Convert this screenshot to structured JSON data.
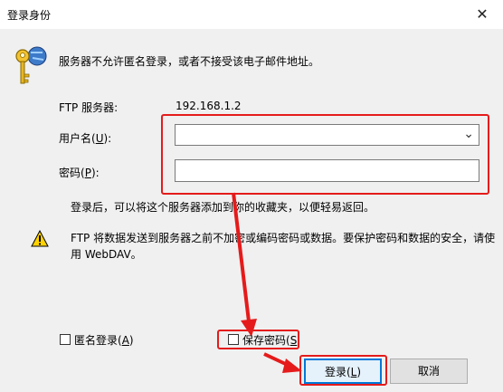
{
  "window": {
    "title": "登录身份",
    "close_glyph": "✕"
  },
  "message": "服务器不允许匿名登录，或者不接受该电子邮件地址。",
  "server": {
    "label": "FTP 服务器:",
    "value": "192.168.1.2"
  },
  "username": {
    "label_prefix": "用户名(",
    "label_key": "U",
    "label_suffix": "):",
    "value": ""
  },
  "password": {
    "label_prefix": "密码(",
    "label_key": "P",
    "label_suffix": "):",
    "value": ""
  },
  "info": "登录后，可以将这个服务器添加到你的收藏夹，以便轻易返回。",
  "warning": {
    "line1": "FTP 将数据发送到服务器之前不加密或编码密码或数据。要保护密码和数据的安全，请使",
    "line2": "用 WebDAV。"
  },
  "anonymous": {
    "label_prefix": "匿名登录(",
    "label_key": "A",
    "label_suffix": ")",
    "checked": false
  },
  "save_password": {
    "label_prefix": "保存密码(",
    "label_key": "S",
    "label_suffix": "",
    "checked": false
  },
  "buttons": {
    "login_prefix": "登录(",
    "login_key": "L",
    "login_suffix": ")",
    "cancel": "取消"
  },
  "colors": {
    "highlight": "#e51b1b",
    "default_button_border": "#0078d7"
  },
  "icons": [
    "keys-icon",
    "warning-icon",
    "chevron-down-icon",
    "close-icon"
  ]
}
